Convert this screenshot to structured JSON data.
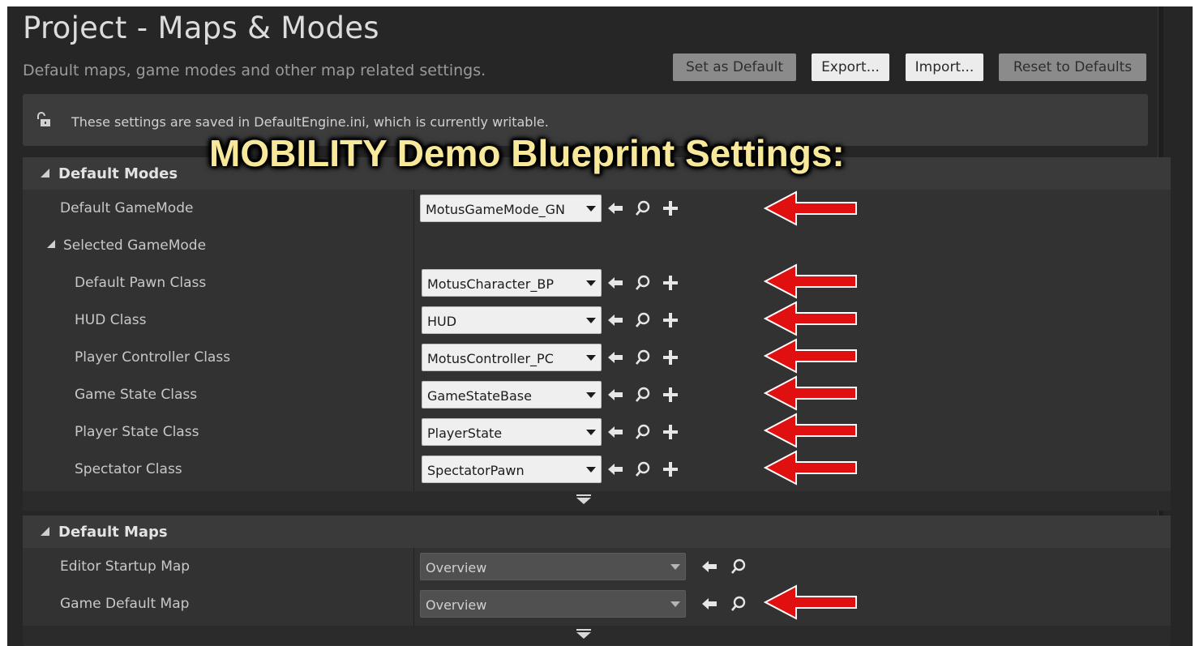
{
  "header": {
    "title": "Project - Maps & Modes",
    "subtitle": "Default maps, game modes and other map related settings."
  },
  "toolbar": {
    "set_default_label": "Set as Default",
    "export_label": "Export...",
    "import_label": "Import...",
    "reset_label": "Reset to Defaults"
  },
  "notice": {
    "text": "These settings are saved in DefaultEngine.ini, which is currently writable.",
    "icon": "unlocked-lock-icon"
  },
  "overlay": {
    "caption": "MOBILITY Demo Blueprint Settings:",
    "arrow_color": "#e01010"
  },
  "default_modes": {
    "header": "Default Modes",
    "default_gamemode": {
      "label": "Default GameMode",
      "value": "MotusGameMode_GN"
    },
    "selected_gamemode_label": "Selected GameMode",
    "rows": [
      {
        "label": "Default Pawn Class",
        "value": "MotusCharacter_BP"
      },
      {
        "label": "HUD Class",
        "value": "HUD"
      },
      {
        "label": "Player Controller Class",
        "value": "MotusController_PC"
      },
      {
        "label": "Game State Class",
        "value": "GameStateBase"
      },
      {
        "label": "Player State Class",
        "value": "PlayerState"
      },
      {
        "label": "Spectator Class",
        "value": "SpectatorPawn"
      }
    ]
  },
  "default_maps": {
    "header": "Default Maps",
    "rows": [
      {
        "label": "Editor Startup Map",
        "value": "Overview"
      },
      {
        "label": "Game Default Map",
        "value": "Overview"
      }
    ]
  }
}
